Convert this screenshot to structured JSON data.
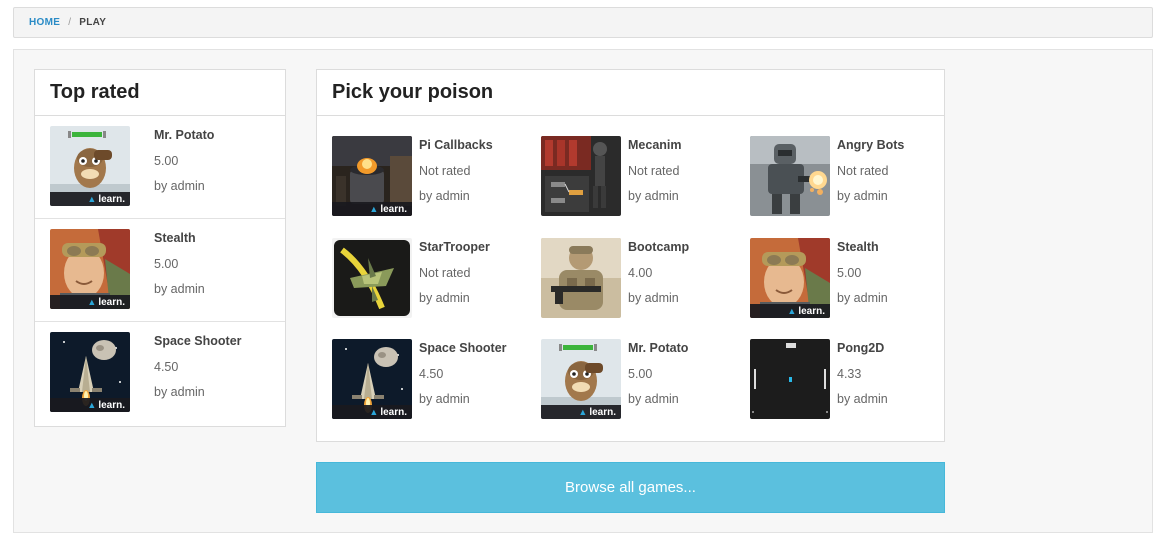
{
  "breadcrumb": {
    "home": "HOME",
    "separator": "/",
    "current": "PLAY"
  },
  "top_rated": {
    "title": "Top rated",
    "items": [
      {
        "title": "Mr. Potato",
        "rating": "5.00",
        "author": "by admin",
        "thumb": "mr-potato",
        "badge": "learn."
      },
      {
        "title": "Stealth",
        "rating": "5.00",
        "author": "by admin",
        "thumb": "stealth",
        "badge": "learn."
      },
      {
        "title": "Space Shooter",
        "rating": "4.50",
        "author": "by admin",
        "thumb": "space-shooter",
        "badge": "learn."
      }
    ]
  },
  "poison": {
    "title": "Pick your poison",
    "games": [
      {
        "title": "Pi Callbacks",
        "rating": "Not rated",
        "author": "by admin",
        "thumb": "pi-callbacks",
        "badge": "learn."
      },
      {
        "title": "Mecanim",
        "rating": "Not rated",
        "author": "by admin",
        "thumb": "mecanim",
        "badge": ""
      },
      {
        "title": "Angry Bots",
        "rating": "Not rated",
        "author": "by admin",
        "thumb": "angry-bots",
        "badge": ""
      },
      {
        "title": "StarTrooper",
        "rating": "Not rated",
        "author": "by admin",
        "thumb": "startrooper",
        "badge": ""
      },
      {
        "title": "Bootcamp",
        "rating": "4.00",
        "author": "by admin",
        "thumb": "bootcamp",
        "badge": ""
      },
      {
        "title": "Stealth",
        "rating": "5.00",
        "author": "by admin",
        "thumb": "stealth",
        "badge": "learn."
      },
      {
        "title": "Space Shooter",
        "rating": "4.50",
        "author": "by admin",
        "thumb": "space-shooter",
        "badge": "learn."
      },
      {
        "title": "Mr. Potato",
        "rating": "5.00",
        "author": "by admin",
        "thumb": "mr-potato",
        "badge": "learn."
      },
      {
        "title": "Pong2D",
        "rating": "4.33",
        "author": "by admin",
        "thumb": "pong2d",
        "badge": ""
      }
    ]
  },
  "browse_button": "Browse all games...",
  "colors": {
    "link": "#2a8bc6",
    "button": "#5bc0de",
    "badge_icon": "#2ba6d9"
  }
}
